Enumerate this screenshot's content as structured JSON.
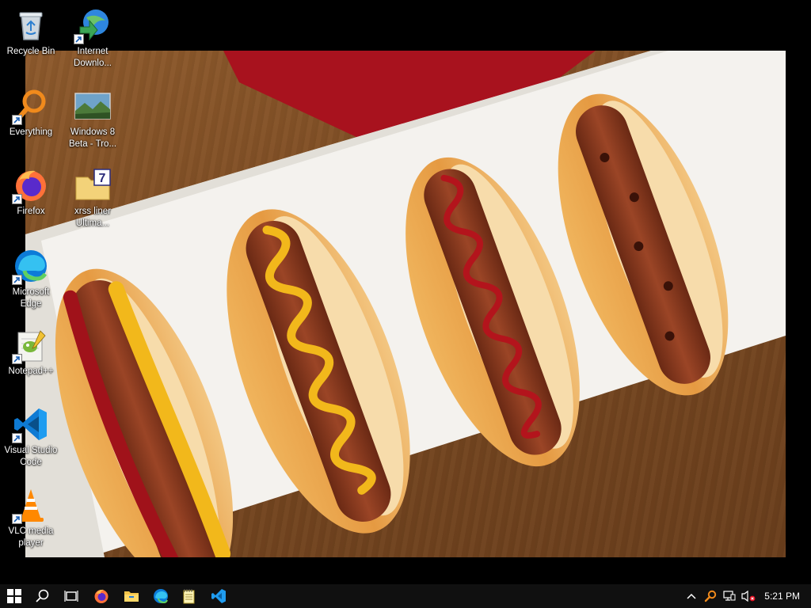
{
  "desktop": {
    "icons": [
      {
        "label": "Recycle Bin",
        "icon": "recycle-bin-icon",
        "shortcut": false
      },
      {
        "label": "Internet\nDownlo...",
        "icon": "internet-download-manager-icon",
        "shortcut": true
      },
      {
        "label": "Everything",
        "icon": "everything-search-icon",
        "shortcut": true
      },
      {
        "label": "Windows 8\nBeta - Tro...",
        "icon": "image-file-icon",
        "shortcut": false
      },
      {
        "label": "Firefox",
        "icon": "firefox-icon",
        "shortcut": true
      },
      {
        "label": "xrss liner\nUltima...",
        "icon": "folder-icon",
        "shortcut": false
      },
      {
        "label": "Microsoft\nEdge",
        "icon": "edge-icon",
        "shortcut": true
      },
      {
        "label": "Notepad++",
        "icon": "notepadpp-icon",
        "shortcut": true
      },
      {
        "label": "Visual Studio\nCode",
        "icon": "vscode-icon",
        "shortcut": true
      },
      {
        "label": "VLC media\nplayer",
        "icon": "vlc-icon",
        "shortcut": true
      }
    ],
    "wallpaper": "hot-dogs-on-white-plate"
  },
  "taskbar": {
    "pinned": [
      "start-icon",
      "search-icon",
      "task-view-icon",
      "firefox-icon",
      "file-explorer-icon",
      "edge-icon",
      "notepad-icon",
      "vscode-icon"
    ],
    "tray": [
      "show-hidden-icons-chevron",
      "everything-search-icon",
      "network-icon",
      "volume-muted-icon"
    ],
    "clock": "5:21 PM"
  },
  "colors": {
    "taskbar": "#101010",
    "bun": "#e9a04c",
    "sausage": "#8a3a1f",
    "ketchup": "#b3141c",
    "mustard": "#f2b81b"
  }
}
